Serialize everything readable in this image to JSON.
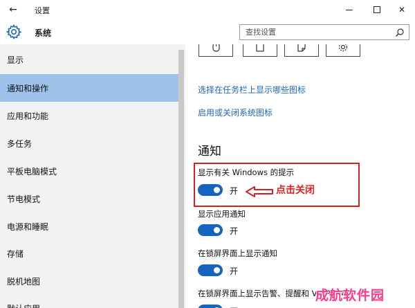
{
  "window": {
    "title": "设置",
    "back_glyph": "←",
    "close_glyph": "✕"
  },
  "header": {
    "section_title": "系统",
    "search_placeholder": "查找设置"
  },
  "sidebar": {
    "items": [
      {
        "label": "显示",
        "selected": false
      },
      {
        "label": "通知和操作",
        "selected": true
      },
      {
        "label": "应用和功能",
        "selected": false
      },
      {
        "label": "多任务",
        "selected": false
      },
      {
        "label": "平板电脑模式",
        "selected": false
      },
      {
        "label": "节电模式",
        "selected": false
      },
      {
        "label": "电源和睡眠",
        "selected": false
      },
      {
        "label": "存储",
        "selected": false
      },
      {
        "label": "脱机地图",
        "selected": false
      },
      {
        "label": "默认应用",
        "selected": false
      }
    ]
  },
  "main": {
    "quick_action_icons": [
      "mouse-icon",
      "clipboard-icon",
      "note-icon",
      "gear-icon"
    ],
    "links": {
      "taskbar_icons": "选择在任务栏上显示哪些图标",
      "system_icons": "启用或关闭系统图标"
    },
    "notifications": {
      "heading": "通知",
      "options": [
        {
          "label": "显示有关 Windows 的提示",
          "state": "开",
          "on": true
        },
        {
          "label": "显示应用通知",
          "state": "开",
          "on": true
        },
        {
          "label": "在锁屏界面上显示通知",
          "state": "开",
          "on": true
        },
        {
          "label": "在锁屏界面上显示告警、提醒和 VOIP 来电",
          "state": "开",
          "on": true
        }
      ]
    },
    "annotation": "点击关闭"
  },
  "watermark": "成航软件园",
  "colors": {
    "accent": "#1565c0",
    "link": "#1d67b8",
    "selected": "#9dc3ea",
    "annotation": "#e02020"
  }
}
